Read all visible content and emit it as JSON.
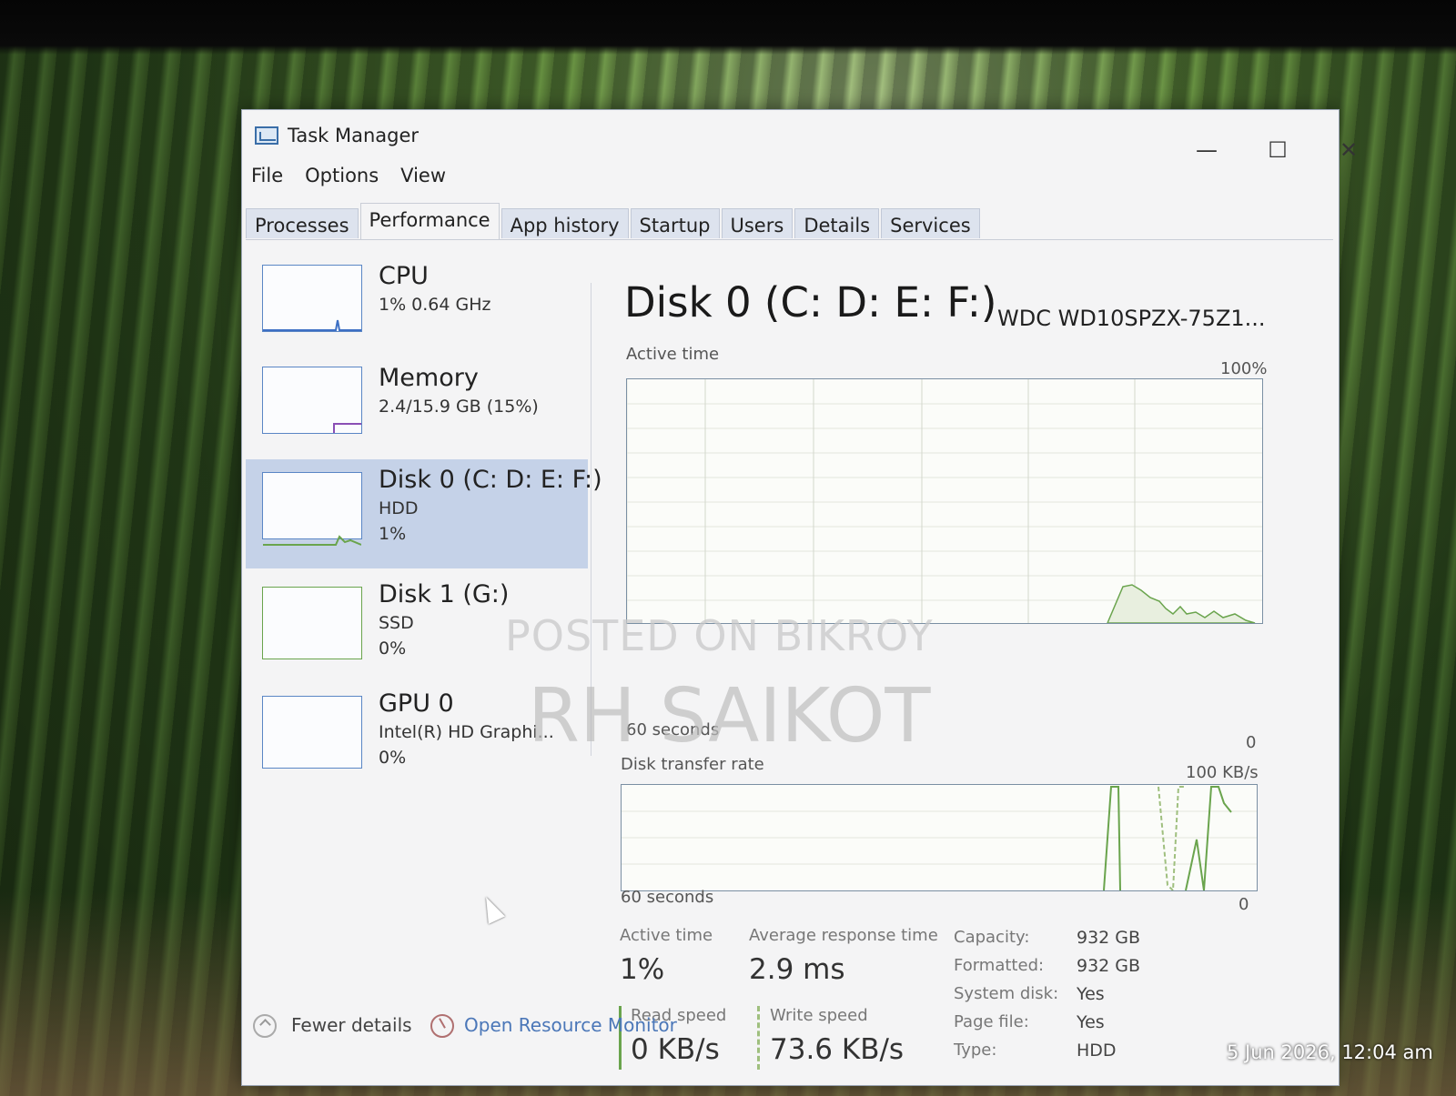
{
  "window": {
    "title": "Task Manager",
    "minimize": "—",
    "maximize": "☐",
    "close": "✕"
  },
  "menu": [
    "File",
    "Options",
    "View"
  ],
  "tabs": [
    "Processes",
    "Performance",
    "App history",
    "Startup",
    "Users",
    "Details",
    "Services"
  ],
  "active_tab": "Performance",
  "sidebar": [
    {
      "title": "CPU",
      "sub1": "1% 0.64 GHz",
      "sub2": ""
    },
    {
      "title": "Memory",
      "sub1": "2.4/15.9 GB (15%)",
      "sub2": ""
    },
    {
      "title": "Disk 0 (C: D: E: F:)",
      "sub1": "HDD",
      "sub2": "1%"
    },
    {
      "title": "Disk 1 (G:)",
      "sub1": "SSD",
      "sub2": "0%"
    },
    {
      "title": "GPU 0",
      "sub1": "Intel(R) HD Graphi...",
      "sub2": "0%"
    }
  ],
  "main": {
    "heading": "Disk 0 (C: D: E: F:)",
    "model": "WDC WD10SPZX-75Z1...",
    "active_graph": {
      "label": "Active time",
      "max_label": "100%",
      "time_label": "60 seconds",
      "min_label": "0"
    },
    "transfer_graph": {
      "label": "Disk transfer rate",
      "max_label": "100 KB/s",
      "time_label": "60 seconds",
      "min_label": "0"
    },
    "stats": {
      "active_time_label": "Active time",
      "active_time_value": "1%",
      "avg_response_label": "Average response time",
      "avg_response_value": "2.9 ms",
      "read_label": "Read speed",
      "read_value": "0 KB/s",
      "write_label": "Write speed",
      "write_value": "73.6 KB/s"
    },
    "properties": [
      {
        "key": "Capacity:",
        "value": "932 GB"
      },
      {
        "key": "Formatted:",
        "value": "932 GB"
      },
      {
        "key": "System disk:",
        "value": "Yes"
      },
      {
        "key": "Page file:",
        "value": "Yes"
      },
      {
        "key": "Type:",
        "value": "HDD"
      }
    ]
  },
  "footer": {
    "fewer_details": "Fewer details",
    "resource_monitor": "Open Resource Monitor"
  },
  "watermark": {
    "line1": "POSTED ON BIKROY",
    "line2": "RH SAIKOT"
  },
  "timestamp": "5 Jun 2026, 12:04 am",
  "colors": {
    "disk_graph_line": "#6aa44d",
    "selected_item": "#c5d2e8",
    "link": "#4b77b8"
  }
}
